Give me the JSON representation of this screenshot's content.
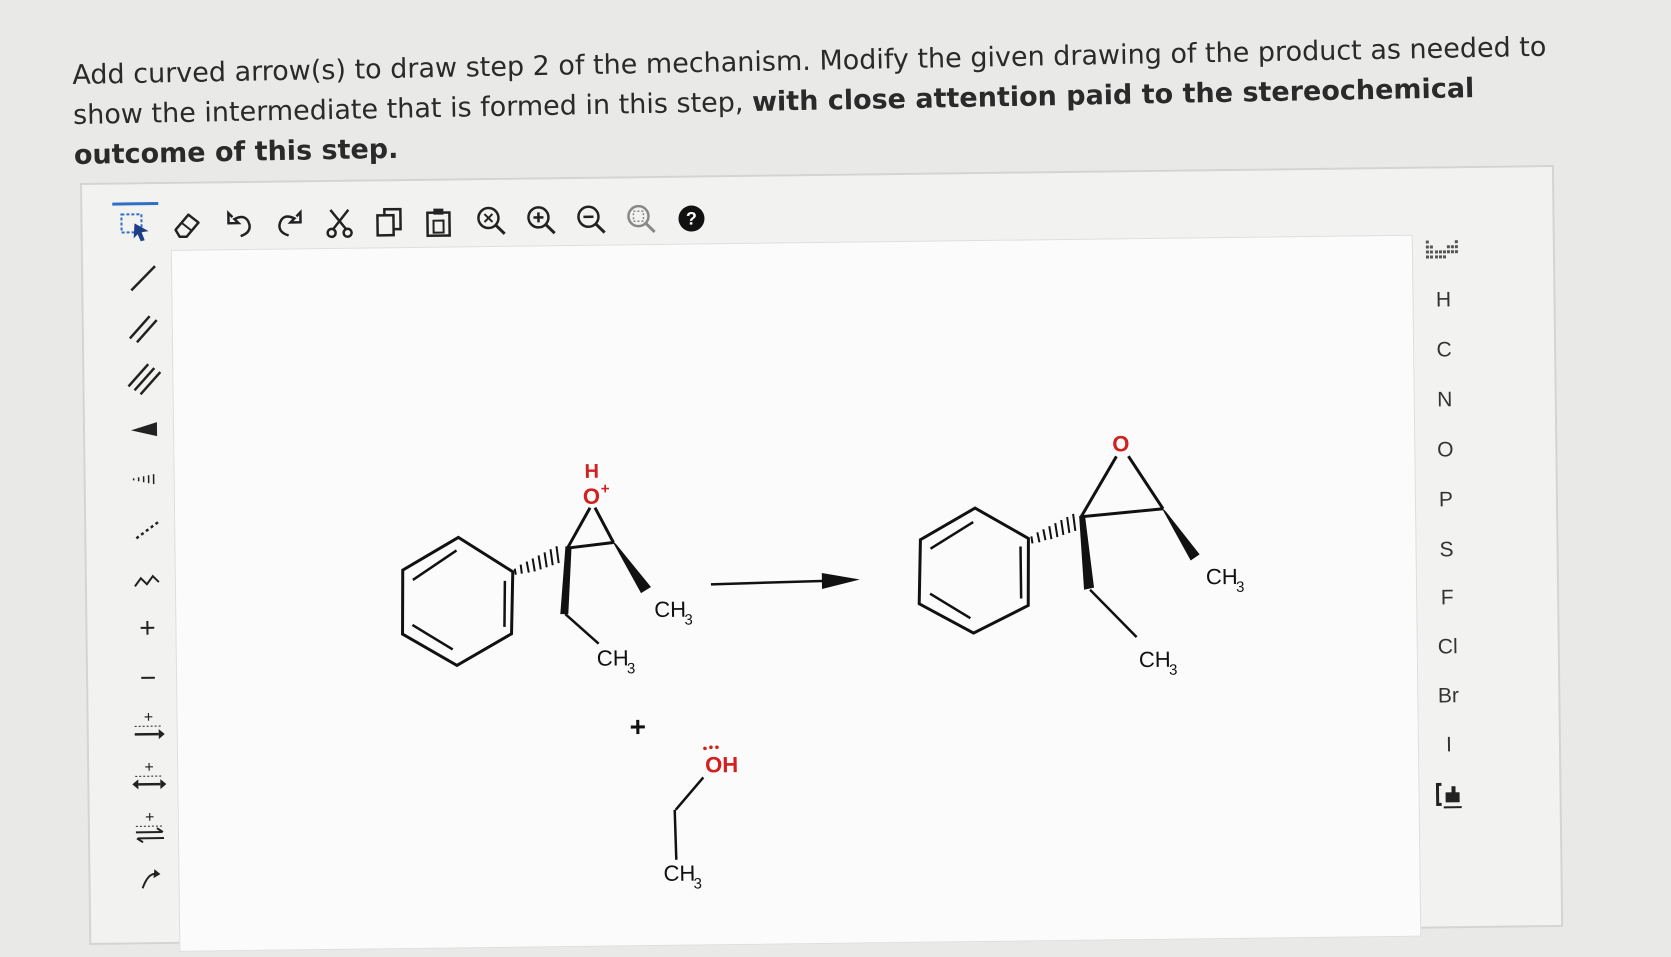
{
  "question": {
    "text_plain": "Add curved arrow(s) to draw step 2 of the mechanism. Modify the given drawing of the product as needed to show the intermediate that is formed in this step, ",
    "text_bold": "with close attention paid to the stereochemical outcome of this step."
  },
  "toolbar_top": [
    {
      "name": "select-tool-icon",
      "label": "select"
    },
    {
      "name": "eraser-icon",
      "label": "erase"
    },
    {
      "name": "undo-icon",
      "label": "undo"
    },
    {
      "name": "redo-icon",
      "label": "redo"
    },
    {
      "name": "cut-icon",
      "label": "cut"
    },
    {
      "name": "copy-icon",
      "label": "copy"
    },
    {
      "name": "paste-icon",
      "label": "paste"
    },
    {
      "name": "zoom-reset-icon",
      "label": "zoom reset"
    },
    {
      "name": "zoom-in-icon",
      "label": "zoom in"
    },
    {
      "name": "zoom-out-icon",
      "label": "zoom out"
    },
    {
      "name": "zoom-fit-icon",
      "label": "zoom fit"
    },
    {
      "name": "help-icon",
      "label": "help"
    }
  ],
  "toolbar_left": [
    {
      "name": "single-bond-icon"
    },
    {
      "name": "double-bond-icon"
    },
    {
      "name": "triple-bond-icon"
    },
    {
      "name": "wedge-bond-icon"
    },
    {
      "name": "hash-bond-icon"
    },
    {
      "name": "dashed-bond-icon"
    },
    {
      "name": "chain-icon"
    },
    {
      "name": "positive-charge-icon",
      "label": "+"
    },
    {
      "name": "negative-charge-icon",
      "label": "−"
    },
    {
      "name": "reaction-arrow-icon"
    },
    {
      "name": "resonance-arrow-icon"
    },
    {
      "name": "equilibrium-arrow-icon"
    },
    {
      "name": "curved-arrow-icon"
    }
  ],
  "toolbar_right": {
    "periodic_table_icon": "periodic-table-icon",
    "elements": [
      "H",
      "C",
      "N",
      "O",
      "P",
      "S",
      "F",
      "Cl",
      "Br",
      "I"
    ],
    "bracket_icon": "bracket-icon"
  },
  "canvas": {
    "reactant": {
      "oxonium_h": "H",
      "oxonium_o": "O",
      "oxonium_charge": "+",
      "methyl_1": "CH",
      "methyl_1_sub": "3",
      "methyl_2": "CH",
      "methyl_2_sub": "3"
    },
    "plus_sign": "+",
    "ethanol": {
      "oh": "OH",
      "ch3": "CH",
      "ch3_sub": "3"
    },
    "product": {
      "o": "O",
      "methyl_1": "CH",
      "methyl_1_sub": "3",
      "methyl_2": "CH",
      "methyl_2_sub": "3"
    }
  },
  "colors": {
    "oxygen": "#d02020",
    "selected": "#2f6fc6",
    "text": "#2a2a2a"
  }
}
